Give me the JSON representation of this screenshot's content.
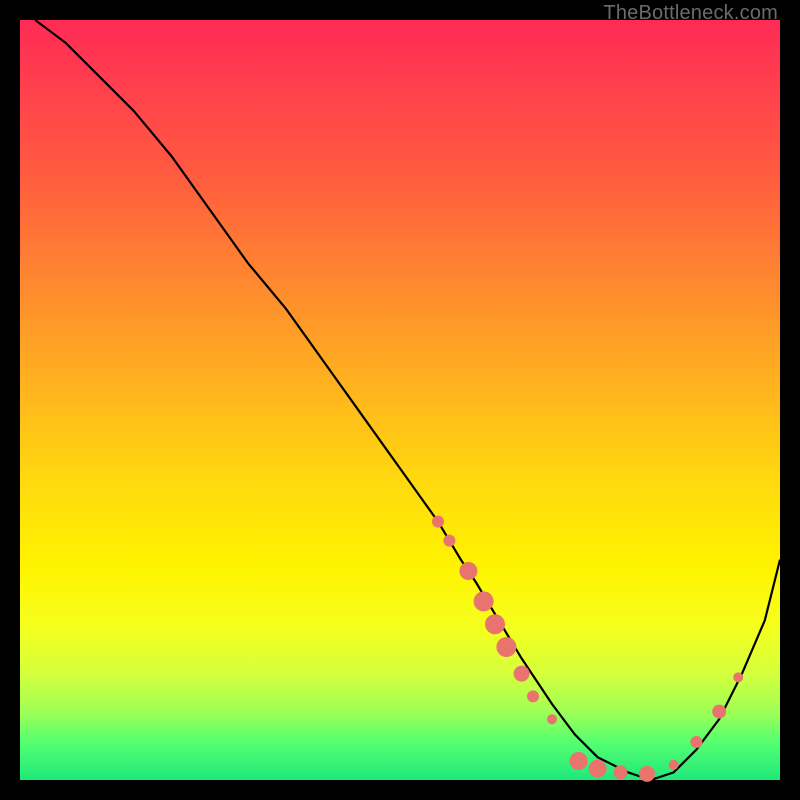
{
  "watermark": "TheBottleneck.com",
  "chart_data": {
    "type": "line",
    "title": "",
    "xlabel": "",
    "ylabel": "",
    "xlim": [
      0,
      100
    ],
    "ylim": [
      0,
      100
    ],
    "series": [
      {
        "name": "curve",
        "x": [
          2,
          6,
          10,
          15,
          20,
          25,
          30,
          35,
          40,
          45,
          50,
          55,
          58,
          60,
          63,
          66,
          70,
          73,
          76,
          80,
          83,
          86,
          89,
          92,
          95,
          98,
          100
        ],
        "y": [
          100,
          97,
          93,
          88,
          82,
          75,
          68,
          62,
          55,
          48,
          41,
          34,
          29,
          26,
          21,
          16,
          10,
          6,
          3,
          1,
          0,
          1,
          4,
          8,
          14,
          21,
          29
        ]
      }
    ],
    "markers": [
      {
        "x": 55,
        "y": 34,
        "r": 6
      },
      {
        "x": 56.5,
        "y": 31.5,
        "r": 6
      },
      {
        "x": 59,
        "y": 27.5,
        "r": 9
      },
      {
        "x": 61,
        "y": 23.5,
        "r": 10
      },
      {
        "x": 62.5,
        "y": 20.5,
        "r": 10
      },
      {
        "x": 64,
        "y": 17.5,
        "r": 10
      },
      {
        "x": 66,
        "y": 14,
        "r": 8
      },
      {
        "x": 67.5,
        "y": 11,
        "r": 6
      },
      {
        "x": 70,
        "y": 8,
        "r": 5
      },
      {
        "x": 73.5,
        "y": 2.5,
        "r": 9
      },
      {
        "x": 76,
        "y": 1.5,
        "r": 9
      },
      {
        "x": 79,
        "y": 1,
        "r": 7
      },
      {
        "x": 82.5,
        "y": 0.8,
        "r": 8
      },
      {
        "x": 86,
        "y": 2,
        "r": 5
      },
      {
        "x": 89,
        "y": 5,
        "r": 6
      },
      {
        "x": 92,
        "y": 9,
        "r": 7
      },
      {
        "x": 94.5,
        "y": 13.5,
        "r": 5
      }
    ],
    "marker_color": "#e9736d",
    "curve_color": "#000000"
  }
}
